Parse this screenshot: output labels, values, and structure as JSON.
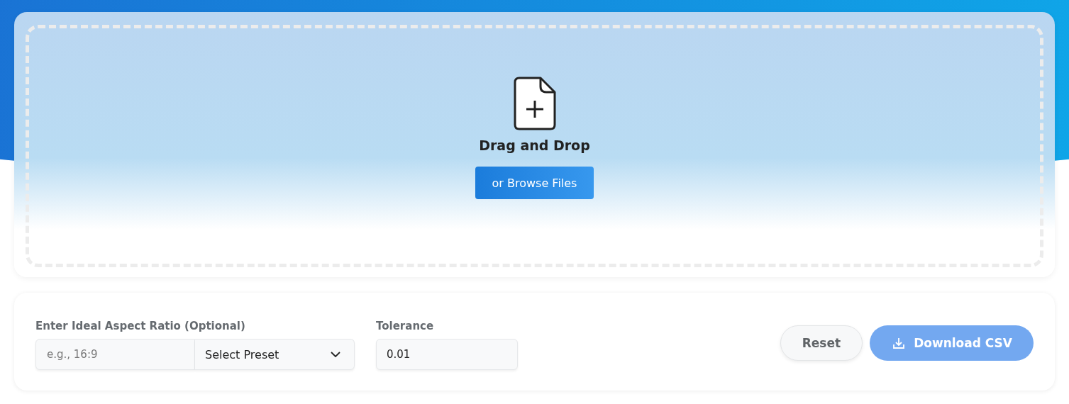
{
  "dropzone": {
    "title": "Drag and Drop",
    "browse_button": "or Browse Files"
  },
  "controls": {
    "ratio_label": "Enter Ideal Aspect Ratio (Optional)",
    "ratio_placeholder": "e.g., 16:9",
    "preset": "Select Preset",
    "tolerance_label": "Tolerance",
    "tolerance_value": "0.01"
  },
  "actions": [
    {
      "label": "Reset",
      "kind": "secondary",
      "disabled": false
    },
    {
      "label": "Download CSV",
      "kind": "download",
      "disabled": true
    }
  ]
}
